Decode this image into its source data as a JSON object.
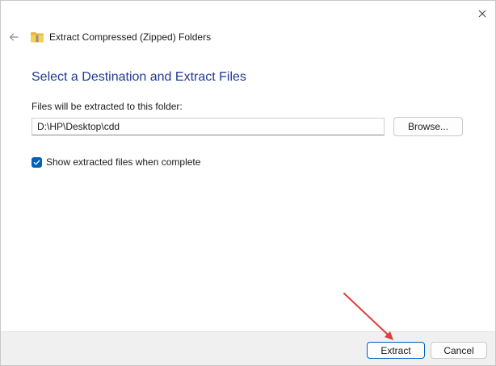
{
  "window": {
    "title": "Extract Compressed (Zipped) Folders",
    "close_icon": "close-icon",
    "back_icon": "back-arrow-icon",
    "folder_icon": "zipped-folder-icon"
  },
  "main": {
    "heading": "Select a Destination and Extract Files",
    "destination_label": "Files will be extracted to this folder:",
    "destination_value": "D:\\HP\\Desktop\\cdd",
    "browse_label": "Browse...",
    "show_files_label": "Show extracted files when complete",
    "show_files_checked": true
  },
  "footer": {
    "extract_label": "Extract",
    "cancel_label": "Cancel"
  },
  "colors": {
    "heading": "#1f3a93",
    "accent": "#005fb8",
    "annotation_arrow": "#d9403a",
    "footer_bg": "#f0f0f0"
  }
}
